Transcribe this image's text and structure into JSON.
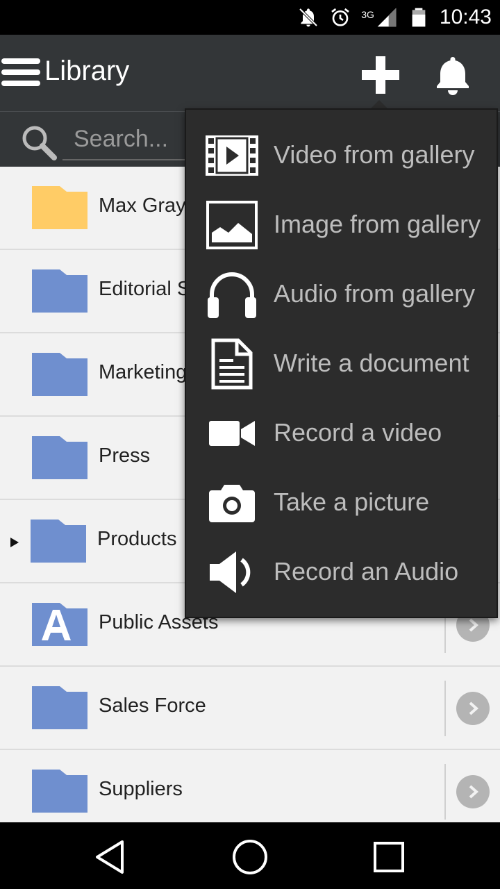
{
  "status_bar": {
    "network": "3G",
    "time": "10:43",
    "icons": [
      "notifications-off-icon",
      "alarm-icon",
      "signal-icon",
      "battery-icon"
    ]
  },
  "app_bar": {
    "title": "Library",
    "actions": [
      "add-icon",
      "bell-icon"
    ]
  },
  "search": {
    "placeholder": "Search..."
  },
  "list": {
    "items": [
      {
        "label": "Max Gray",
        "folder_color": "#ffcc66",
        "icon": "folder-icon",
        "expandable": false,
        "has_chevron": false
      },
      {
        "label": "Editorial S",
        "folder_color": "#6f8fcf",
        "icon": "folder-icon",
        "expandable": false,
        "has_chevron": false
      },
      {
        "label": "Marketing",
        "folder_color": "#6f8fcf",
        "icon": "folder-icon",
        "expandable": false,
        "has_chevron": false
      },
      {
        "label": "Press",
        "folder_color": "#6f8fcf",
        "icon": "folder-icon",
        "expandable": false,
        "has_chevron": false
      },
      {
        "label": "Products",
        "folder_color": "#6f8fcf",
        "icon": "folder-icon",
        "expandable": true,
        "has_chevron": false
      },
      {
        "label": "Public Assets",
        "folder_color": "#6f8fcf",
        "icon": "public-assets-icon",
        "expandable": false,
        "has_chevron": true
      },
      {
        "label": "Sales Force",
        "folder_color": "#6f8fcf",
        "icon": "folder-icon",
        "expandable": false,
        "has_chevron": true
      },
      {
        "label": "Suppliers",
        "folder_color": "#6f8fcf",
        "icon": "folder-icon",
        "expandable": false,
        "has_chevron": true
      }
    ]
  },
  "popup_menu": {
    "items": [
      {
        "label": "Video from gallery",
        "icon": "film-icon"
      },
      {
        "label": "Image from gallery",
        "icon": "image-icon"
      },
      {
        "label": "Audio from gallery",
        "icon": "headphones-icon"
      },
      {
        "label": "Write a document",
        "icon": "document-icon"
      },
      {
        "label": "Record a video",
        "icon": "video-camera-icon"
      },
      {
        "label": "Take a picture",
        "icon": "camera-icon"
      },
      {
        "label": "Record an Audio",
        "icon": "speaker-icon"
      }
    ]
  },
  "nav_bar": {
    "buttons": [
      "back-icon",
      "home-icon",
      "recents-icon"
    ]
  },
  "colors": {
    "app_bar": "#333638",
    "popup": "#2c2c2c",
    "folder_blue": "#6f8fcf",
    "folder_yellow": "#ffcc66",
    "list_bg": "#f2f2f2"
  }
}
